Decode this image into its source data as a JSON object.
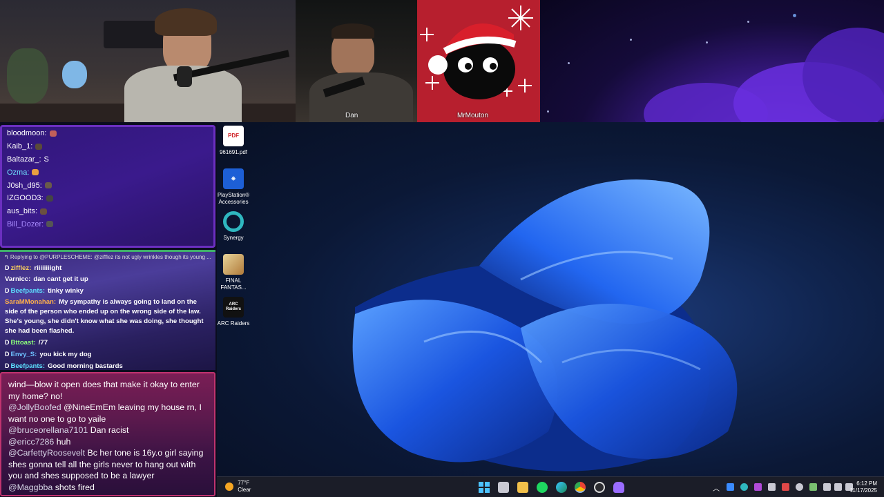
{
  "cams": {
    "cam2_label": "Dan",
    "cam3_label": "MrMouton"
  },
  "desktop_icons": [
    {
      "label": "961691.pdf",
      "icon": "pdf-icon",
      "badge": "PDF"
    },
    {
      "label": "PlayStation® Accessories",
      "icon": "playstation-icon",
      "badge": ""
    },
    {
      "label": "Synergy",
      "icon": "synergy-icon",
      "badge": ""
    },
    {
      "label": "FINAL FANTAS...",
      "icon": "final-fantasy-icon",
      "badge": ""
    },
    {
      "label": "ARC Raiders",
      "icon": "arc-raiders-icon",
      "badge": "ARC Raiders"
    }
  ],
  "viewers_chat": [
    {
      "user": "bloodmoon:",
      "color": "#ffffff"
    },
    {
      "user": "Kaib_1:",
      "color": "#ffffff"
    },
    {
      "user": "Baltazar_:",
      "text": "S",
      "color": "#ffffff"
    },
    {
      "user": "Ozma:",
      "color": "#6fe3ff"
    },
    {
      "user": "J0sh_d95:",
      "color": "#ffffff"
    },
    {
      "user": "IZGOOD3:",
      "color": "#ffffff"
    },
    {
      "user": "aus_bits:",
      "color": "#ffffff"
    },
    {
      "user": "Bill_Dozer:",
      "color": "#a98cff"
    }
  ],
  "twitch_chat": {
    "reply": "↰ Replying to @PURPLESCHEME: @zifflez its not ugly wrinkles though its young ...",
    "messages": [
      {
        "user": "zifflez:",
        "text": "riiiiiiiight",
        "color": "#ffd35c",
        "badge": "D"
      },
      {
        "user": "Varnicc:",
        "text": "dan cant get it up",
        "color": "#ffffff",
        "badge": ""
      },
      {
        "user": "Beefpants:",
        "text": "tinky winky",
        "color": "#5de0ff",
        "badge": "D"
      },
      {
        "user": "SaraMMonahan:",
        "text": "My sympathy is always going to land on the side of the person who ended up on the wrong side of the law. She's young, she didn't know what she was doing, she thought she had been flashed.",
        "color": "#ffb04a",
        "badge": ""
      },
      {
        "user": "Bttoast:",
        "text": "/77",
        "color": "#8cff7a",
        "badge": "D"
      },
      {
        "user": "Envy_S:",
        "text": "you kick my dog",
        "color": "#6ec1ff",
        "badge": "D"
      },
      {
        "user": "Beefpants:",
        "text": "Good morning bastards",
        "color": "#5de0ff",
        "badge": "D"
      }
    ]
  },
  "yt_chat": [
    {
      "user": "",
      "text": "wind—blow it open does that make it okay to enter my home? no!"
    },
    {
      "user": "@JollyBoofed",
      "text": "@NineEmEm leaving my house rn, I want no one to go to yaile"
    },
    {
      "user": "@bruceorellana7101",
      "text": "Dan racist"
    },
    {
      "user": "@ericc7286",
      "text": "huh"
    },
    {
      "user": "@CarfettyRoosevelt",
      "text": "Bc her tone is 16y.o girl saying shes gonna tell all the girls never to hang out with you and shes supposed to be a lawyer"
    },
    {
      "user": "@Maggbba",
      "text": "shots fired"
    }
  ],
  "taskbar": {
    "weather_temp": "77°F",
    "weather_desc": "Clear",
    "time": "6:12 PM",
    "date": "11/17/2025",
    "apps": [
      "start-icon",
      "task-view-icon",
      "file-explorer-icon",
      "spotify-icon",
      "edge-icon",
      "chrome-icon",
      "obs-icon",
      "app-icon"
    ]
  }
}
